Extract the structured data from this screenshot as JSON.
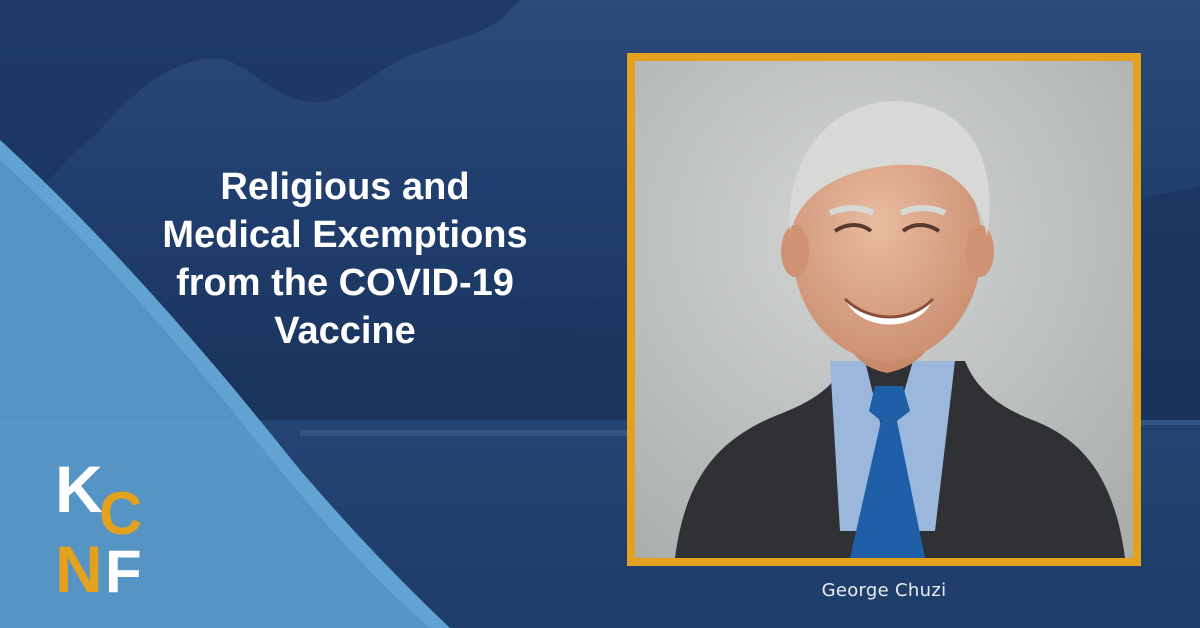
{
  "headline": {
    "line1": "Religious and",
    "line2": "Medical Exemptions",
    "line3": "from the COVID-19",
    "line4": "Vaccine"
  },
  "logo": {
    "letters": [
      "K",
      "C",
      "N",
      "F"
    ],
    "colors": {
      "orange": "#e3a11e",
      "white": "#ffffff"
    }
  },
  "photo": {
    "caption": "George Chuzi",
    "frame_color": "#e3a11e"
  },
  "colors": {
    "navy": "#1d3a66",
    "light_blue": "#5fa3d3",
    "gold": "#e3a11e"
  }
}
